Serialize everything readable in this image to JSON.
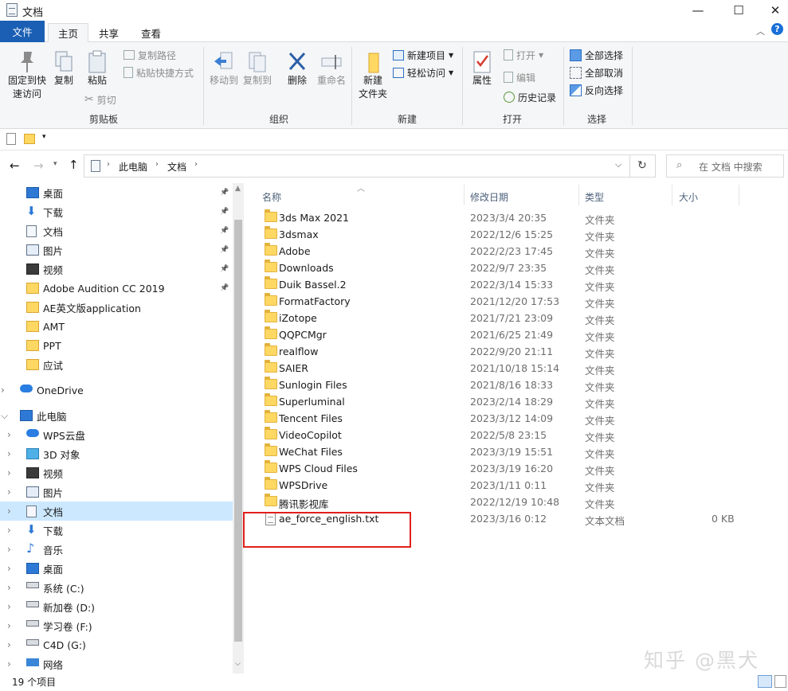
{
  "window": {
    "title": "文档",
    "min_label": "—",
    "max_label": "☐",
    "close_label": "✕"
  },
  "tabs": {
    "file": "文件",
    "home": "主页",
    "share": "共享",
    "view": "查看"
  },
  "ribbon": {
    "clipboard": {
      "pin": "固定到快\n速访问",
      "copy": "复制",
      "paste": "粘贴",
      "copy_path": "复制路径",
      "paste_shortcut": "粘贴快捷方式",
      "cut": "剪切",
      "label": "剪贴板"
    },
    "organize": {
      "move_to": "移动到",
      "copy_to": "复制到",
      "delete": "删除",
      "rename": "重命名",
      "label": "组织"
    },
    "new": {
      "new_folder": "新建\n文件夹",
      "new_item": "新建项目",
      "easy_access": "轻松访问",
      "label": "新建"
    },
    "open": {
      "properties": "属性",
      "open": "打开",
      "edit": "编辑",
      "history": "历史记录",
      "label": "打开"
    },
    "select": {
      "select_all": "全部选择",
      "select_none": "全部取消",
      "invert": "反向选择",
      "label": "选择"
    }
  },
  "address": {
    "crumb1": "此电脑",
    "crumb2": "文档",
    "search_placeholder": "在 文档 中搜索"
  },
  "nav": {
    "quick": [
      {
        "label": "桌面",
        "pinned": true,
        "icon": "desktop"
      },
      {
        "label": "下载",
        "pinned": true,
        "icon": "download"
      },
      {
        "label": "文档",
        "pinned": true,
        "icon": "document"
      },
      {
        "label": "图片",
        "pinned": true,
        "icon": "pictures"
      },
      {
        "label": "视频",
        "pinned": true,
        "icon": "video"
      },
      {
        "label": "Adobe Audition CC 2019",
        "pinned": true,
        "icon": "folder"
      },
      {
        "label": "AE英文版application",
        "pinned": false,
        "icon": "folder"
      },
      {
        "label": "AMT",
        "pinned": false,
        "icon": "folder"
      },
      {
        "label": "PPT",
        "pinned": false,
        "icon": "folder"
      },
      {
        "label": "应试",
        "pinned": false,
        "icon": "folder"
      }
    ],
    "onedrive": "OneDrive",
    "thispc": "此电脑",
    "pc_items": [
      {
        "label": "WPS云盘",
        "icon": "cloud"
      },
      {
        "label": "3D 对象",
        "icon": "cube"
      },
      {
        "label": "视频",
        "icon": "video"
      },
      {
        "label": "图片",
        "icon": "pictures"
      },
      {
        "label": "文档",
        "icon": "document",
        "selected": true
      },
      {
        "label": "下载",
        "icon": "download"
      },
      {
        "label": "音乐",
        "icon": "music"
      },
      {
        "label": "桌面",
        "icon": "desktop"
      },
      {
        "label": "系统 (C:)",
        "icon": "drive-sys"
      },
      {
        "label": "新加卷 (D:)",
        "icon": "drive"
      },
      {
        "label": "学习卷 (F:)",
        "icon": "drive"
      },
      {
        "label": "C4D (G:)",
        "icon": "drive"
      },
      {
        "label": "网络",
        "icon": "network"
      }
    ]
  },
  "columns": {
    "name": "名称",
    "date": "修改日期",
    "type": "类型",
    "size": "大小"
  },
  "files": [
    {
      "name": "3ds Max 2021",
      "date": "2023/3/4 20:35",
      "type": "文件夹",
      "size": ""
    },
    {
      "name": "3dsmax",
      "date": "2022/12/6 15:25",
      "type": "文件夹",
      "size": ""
    },
    {
      "name": "Adobe",
      "date": "2022/2/23 17:45",
      "type": "文件夹",
      "size": ""
    },
    {
      "name": "Downloads",
      "date": "2022/9/7 23:35",
      "type": "文件夹",
      "size": ""
    },
    {
      "name": "Duik Bassel.2",
      "date": "2022/3/14 15:33",
      "type": "文件夹",
      "size": ""
    },
    {
      "name": "FormatFactory",
      "date": "2021/12/20 17:53",
      "type": "文件夹",
      "size": ""
    },
    {
      "name": "iZotope",
      "date": "2021/7/21 23:09",
      "type": "文件夹",
      "size": ""
    },
    {
      "name": "QQPCMgr",
      "date": "2021/6/25 21:49",
      "type": "文件夹",
      "size": ""
    },
    {
      "name": "realflow",
      "date": "2022/9/20 21:11",
      "type": "文件夹",
      "size": ""
    },
    {
      "name": "SAIER",
      "date": "2021/10/18 15:14",
      "type": "文件夹",
      "size": ""
    },
    {
      "name": "Sunlogin Files",
      "date": "2021/8/16 18:33",
      "type": "文件夹",
      "size": ""
    },
    {
      "name": "Superluminal",
      "date": "2023/2/14 18:29",
      "type": "文件夹",
      "size": ""
    },
    {
      "name": "Tencent Files",
      "date": "2023/3/12 14:09",
      "type": "文件夹",
      "size": ""
    },
    {
      "name": "VideoCopilot",
      "date": "2022/5/8 23:15",
      "type": "文件夹",
      "size": ""
    },
    {
      "name": "WeChat Files",
      "date": "2023/3/19 15:51",
      "type": "文件夹",
      "size": ""
    },
    {
      "name": "WPS Cloud Files",
      "date": "2023/3/19 16:20",
      "type": "文件夹",
      "size": ""
    },
    {
      "name": "WPSDrive",
      "date": "2023/1/11 0:11",
      "type": "文件夹",
      "size": ""
    },
    {
      "name": "腾讯影视库",
      "date": "2022/12/19 10:48",
      "type": "文件夹",
      "size": ""
    },
    {
      "name": "ae_force_english.txt",
      "date": "2023/3/16 0:12",
      "type": "文本文档",
      "size": "0 KB",
      "is_file": true
    }
  ],
  "status": {
    "count": "19 个项目"
  },
  "watermark": "知乎 @黑犬",
  "colors": {
    "accent": "#1a5fb4",
    "selection": "#cce8ff",
    "highlight_box": "#e0201b",
    "folder": "#ffd863"
  }
}
